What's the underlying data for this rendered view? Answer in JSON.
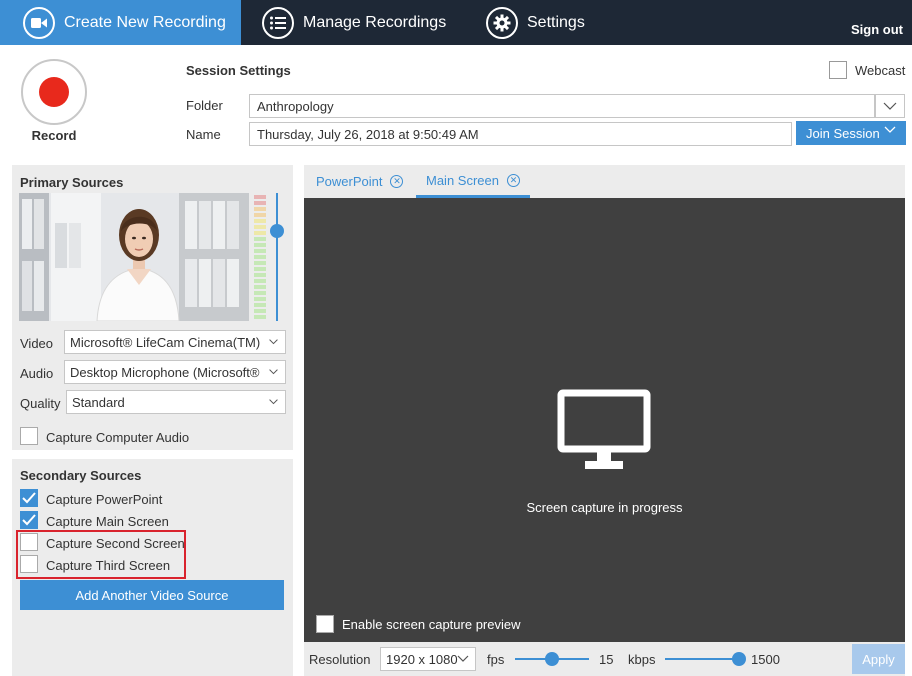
{
  "nav": {
    "tabs": [
      {
        "label": "Create New Recording",
        "icon": "video-camera-icon",
        "active": true
      },
      {
        "label": "Manage Recordings",
        "icon": "list-icon",
        "active": false
      },
      {
        "label": "Settings",
        "icon": "gear-icon",
        "active": false
      }
    ],
    "sign_out": "Sign out"
  },
  "record": {
    "label": "Record"
  },
  "session": {
    "title": "Session Settings",
    "folder_label": "Folder",
    "folder_value": "Anthropology",
    "name_label": "Name",
    "name_value": "Thursday, July 26, 2018 at 9:50:49 AM",
    "join_button": "Join Session",
    "webcast_label": "Webcast",
    "webcast_checked": false
  },
  "primary": {
    "title": "Primary Sources",
    "video_label": "Video",
    "video_value": "Microsoft® LifeCam Cinema(TM)",
    "audio_label": "Audio",
    "audio_value": "Desktop Microphone (Microsoft®",
    "quality_label": "Quality",
    "quality_value": "Standard",
    "capture_audio_label": "Capture Computer Audio",
    "capture_audio_checked": false
  },
  "secondary": {
    "title": "Secondary Sources",
    "items": [
      {
        "label": "Capture PowerPoint",
        "checked": true
      },
      {
        "label": "Capture Main Screen",
        "checked": true
      },
      {
        "label": "Capture Second Screen",
        "checked": false
      },
      {
        "label": "Capture Third Screen",
        "checked": false
      }
    ],
    "add_button": "Add Another Video Source"
  },
  "tabs": [
    {
      "label": "PowerPoint",
      "active": false
    },
    {
      "label": "Main Screen",
      "active": true
    }
  ],
  "preview": {
    "status": "Screen capture in progress",
    "enable_label": "Enable screen capture preview"
  },
  "bottom": {
    "resolution_label": "Resolution",
    "resolution_value": "1920 x 1080",
    "fps_label": "fps",
    "fps_value": "15",
    "kbps_label": "kbps",
    "kbps_value": "1500",
    "apply": "Apply"
  },
  "colors": {
    "accent": "#3d8fd4",
    "nav_bg": "#1e2836",
    "record": "#e8291c",
    "highlight": "#d9232d"
  }
}
